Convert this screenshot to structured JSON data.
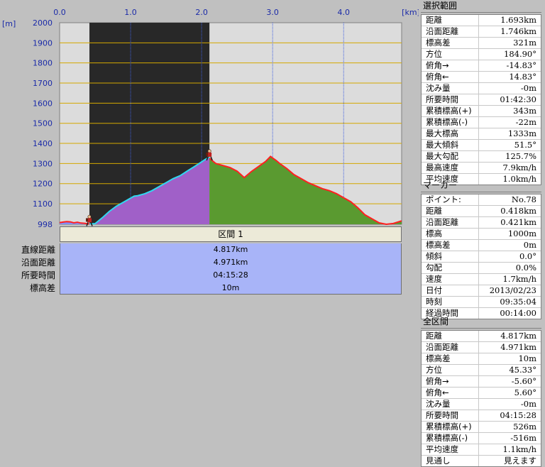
{
  "chart_data": {
    "type": "area",
    "x_axis": {
      "unit_label": "[km]",
      "ticks": [
        "0.0",
        "1.0",
        "2.0",
        "3.0",
        "4.0"
      ],
      "range": [
        0,
        4.817
      ]
    },
    "y_axis": {
      "unit_label": "[m]",
      "ticks": [
        "2000",
        "1900",
        "1800",
        "1700",
        "1600",
        "1500",
        "1400",
        "1300",
        "1200",
        "1100",
        "998"
      ],
      "range": [
        998,
        2000
      ]
    },
    "selection": {
      "start_km": 0.42,
      "end_km": 2.11
    },
    "marker_km": 0.42,
    "series": [
      {
        "x": [
          0,
          0.05,
          0.1,
          0.15,
          0.2,
          0.25,
          0.3,
          0.35,
          0.4,
          0.42,
          0.5,
          0.6,
          0.7,
          0.8,
          0.9,
          1.0,
          1.05,
          1.1,
          1.2,
          1.3,
          1.4,
          1.5,
          1.6,
          1.7,
          1.8,
          1.9,
          2.0,
          2.05,
          2.1,
          2.12,
          2.2,
          2.3,
          2.4,
          2.5,
          2.6,
          2.7,
          2.8,
          2.9,
          2.97,
          3.05,
          3.1,
          3.2,
          3.3,
          3.4,
          3.5,
          3.6,
          3.7,
          3.8,
          3.9,
          4.0,
          4.1,
          4.2,
          4.3,
          4.4,
          4.5,
          4.6,
          4.7,
          4.817
        ],
        "y": [
          1006,
          1009,
          1011,
          1010,
          1005,
          1008,
          1004,
          1003,
          1000,
          1000,
          1001,
          1030,
          1062,
          1088,
          1108,
          1128,
          1138,
          1140,
          1150,
          1165,
          1185,
          1205,
          1225,
          1240,
          1263,
          1285,
          1308,
          1320,
          1330,
          1323,
          1300,
          1290,
          1280,
          1262,
          1230,
          1260,
          1285,
          1310,
          1335,
          1315,
          1300,
          1275,
          1245,
          1225,
          1205,
          1190,
          1175,
          1165,
          1150,
          1130,
          1110,
          1080,
          1045,
          1025,
          1005,
          998,
          1002,
          1015
        ]
      }
    ]
  },
  "section_table": {
    "header": "区間 1",
    "rows": [
      {
        "label": "直線距離",
        "value": "4.817km"
      },
      {
        "label": "沿面距離",
        "value": "4.971km"
      },
      {
        "label": "所要時間",
        "value": "04:15:28"
      },
      {
        "label": "標高差",
        "value": "10m"
      }
    ]
  },
  "panels": {
    "selection": {
      "title": "選択範囲",
      "rows": [
        {
          "k": "距離",
          "v": "1.693km"
        },
        {
          "k": "沿面距離",
          "v": "1.746km"
        },
        {
          "k": "標高差",
          "v": "321m"
        },
        {
          "k": "方位",
          "v": "184.90°"
        },
        {
          "k": "俯角→",
          "v": "-14.83°"
        },
        {
          "k": "俯角←",
          "v": "14.83°"
        },
        {
          "k": "沈み量",
          "v": "-0m"
        },
        {
          "k": "所要時間",
          "v": "01:42:30"
        },
        {
          "k": "累積標高(+)",
          "v": "343m"
        },
        {
          "k": "累積標高(-)",
          "v": "-22m"
        },
        {
          "k": "最大標高",
          "v": "1333m"
        },
        {
          "k": "最大傾斜",
          "v": "51.5°"
        },
        {
          "k": "最大勾配",
          "v": "125.7%"
        },
        {
          "k": "最高速度",
          "v": "7.9km/h"
        },
        {
          "k": "平均速度",
          "v": "1.0km/h"
        }
      ]
    },
    "marker": {
      "title": "マーカー",
      "rows": [
        {
          "k": "ポイント:",
          "v": "No.78"
        },
        {
          "k": "距離",
          "v": "0.418km"
        },
        {
          "k": "沿面距離",
          "v": "0.421km"
        },
        {
          "k": "標高",
          "v": "1000m"
        },
        {
          "k": "標高差",
          "v": "0m"
        },
        {
          "k": "傾斜",
          "v": "0.0°"
        },
        {
          "k": "勾配",
          "v": "0.0%"
        },
        {
          "k": "速度",
          "v": "1.7km/h"
        },
        {
          "k": "日付",
          "v": "2013/02/23"
        },
        {
          "k": "時刻",
          "v": "09:35:04"
        },
        {
          "k": "経過時間",
          "v": "00:14:00"
        }
      ]
    },
    "total": {
      "title": "全区間",
      "rows": [
        {
          "k": "距離",
          "v": "4.817km"
        },
        {
          "k": "沿面距離",
          "v": "4.971km"
        },
        {
          "k": "標高差",
          "v": "10m"
        },
        {
          "k": "方位",
          "v": "45.33°"
        },
        {
          "k": "俯角→",
          "v": "-5.60°"
        },
        {
          "k": "俯角←",
          "v": "5.60°"
        },
        {
          "k": "沈み量",
          "v": "-0m"
        },
        {
          "k": "所要時間",
          "v": "04:15:28"
        },
        {
          "k": "累積標高(+)",
          "v": "526m"
        },
        {
          "k": "累積標高(-)",
          "v": "-516m"
        },
        {
          "k": "平均速度",
          "v": "1.1km/h"
        },
        {
          "k": "見通し",
          "v": "見えます"
        }
      ]
    }
  },
  "colors": {
    "plot_bg": "#dcdcdc",
    "selection_bg": "#282828",
    "grid_h": "#d4a800",
    "grid_v": "#4060e0",
    "fill_before": "#8090ff",
    "fill_selected": "#a060c8",
    "fill_after": "#5a9a30",
    "line": "#ff2020",
    "line_selected": "#30d8f0",
    "axis_text": "#1a2aa8"
  }
}
